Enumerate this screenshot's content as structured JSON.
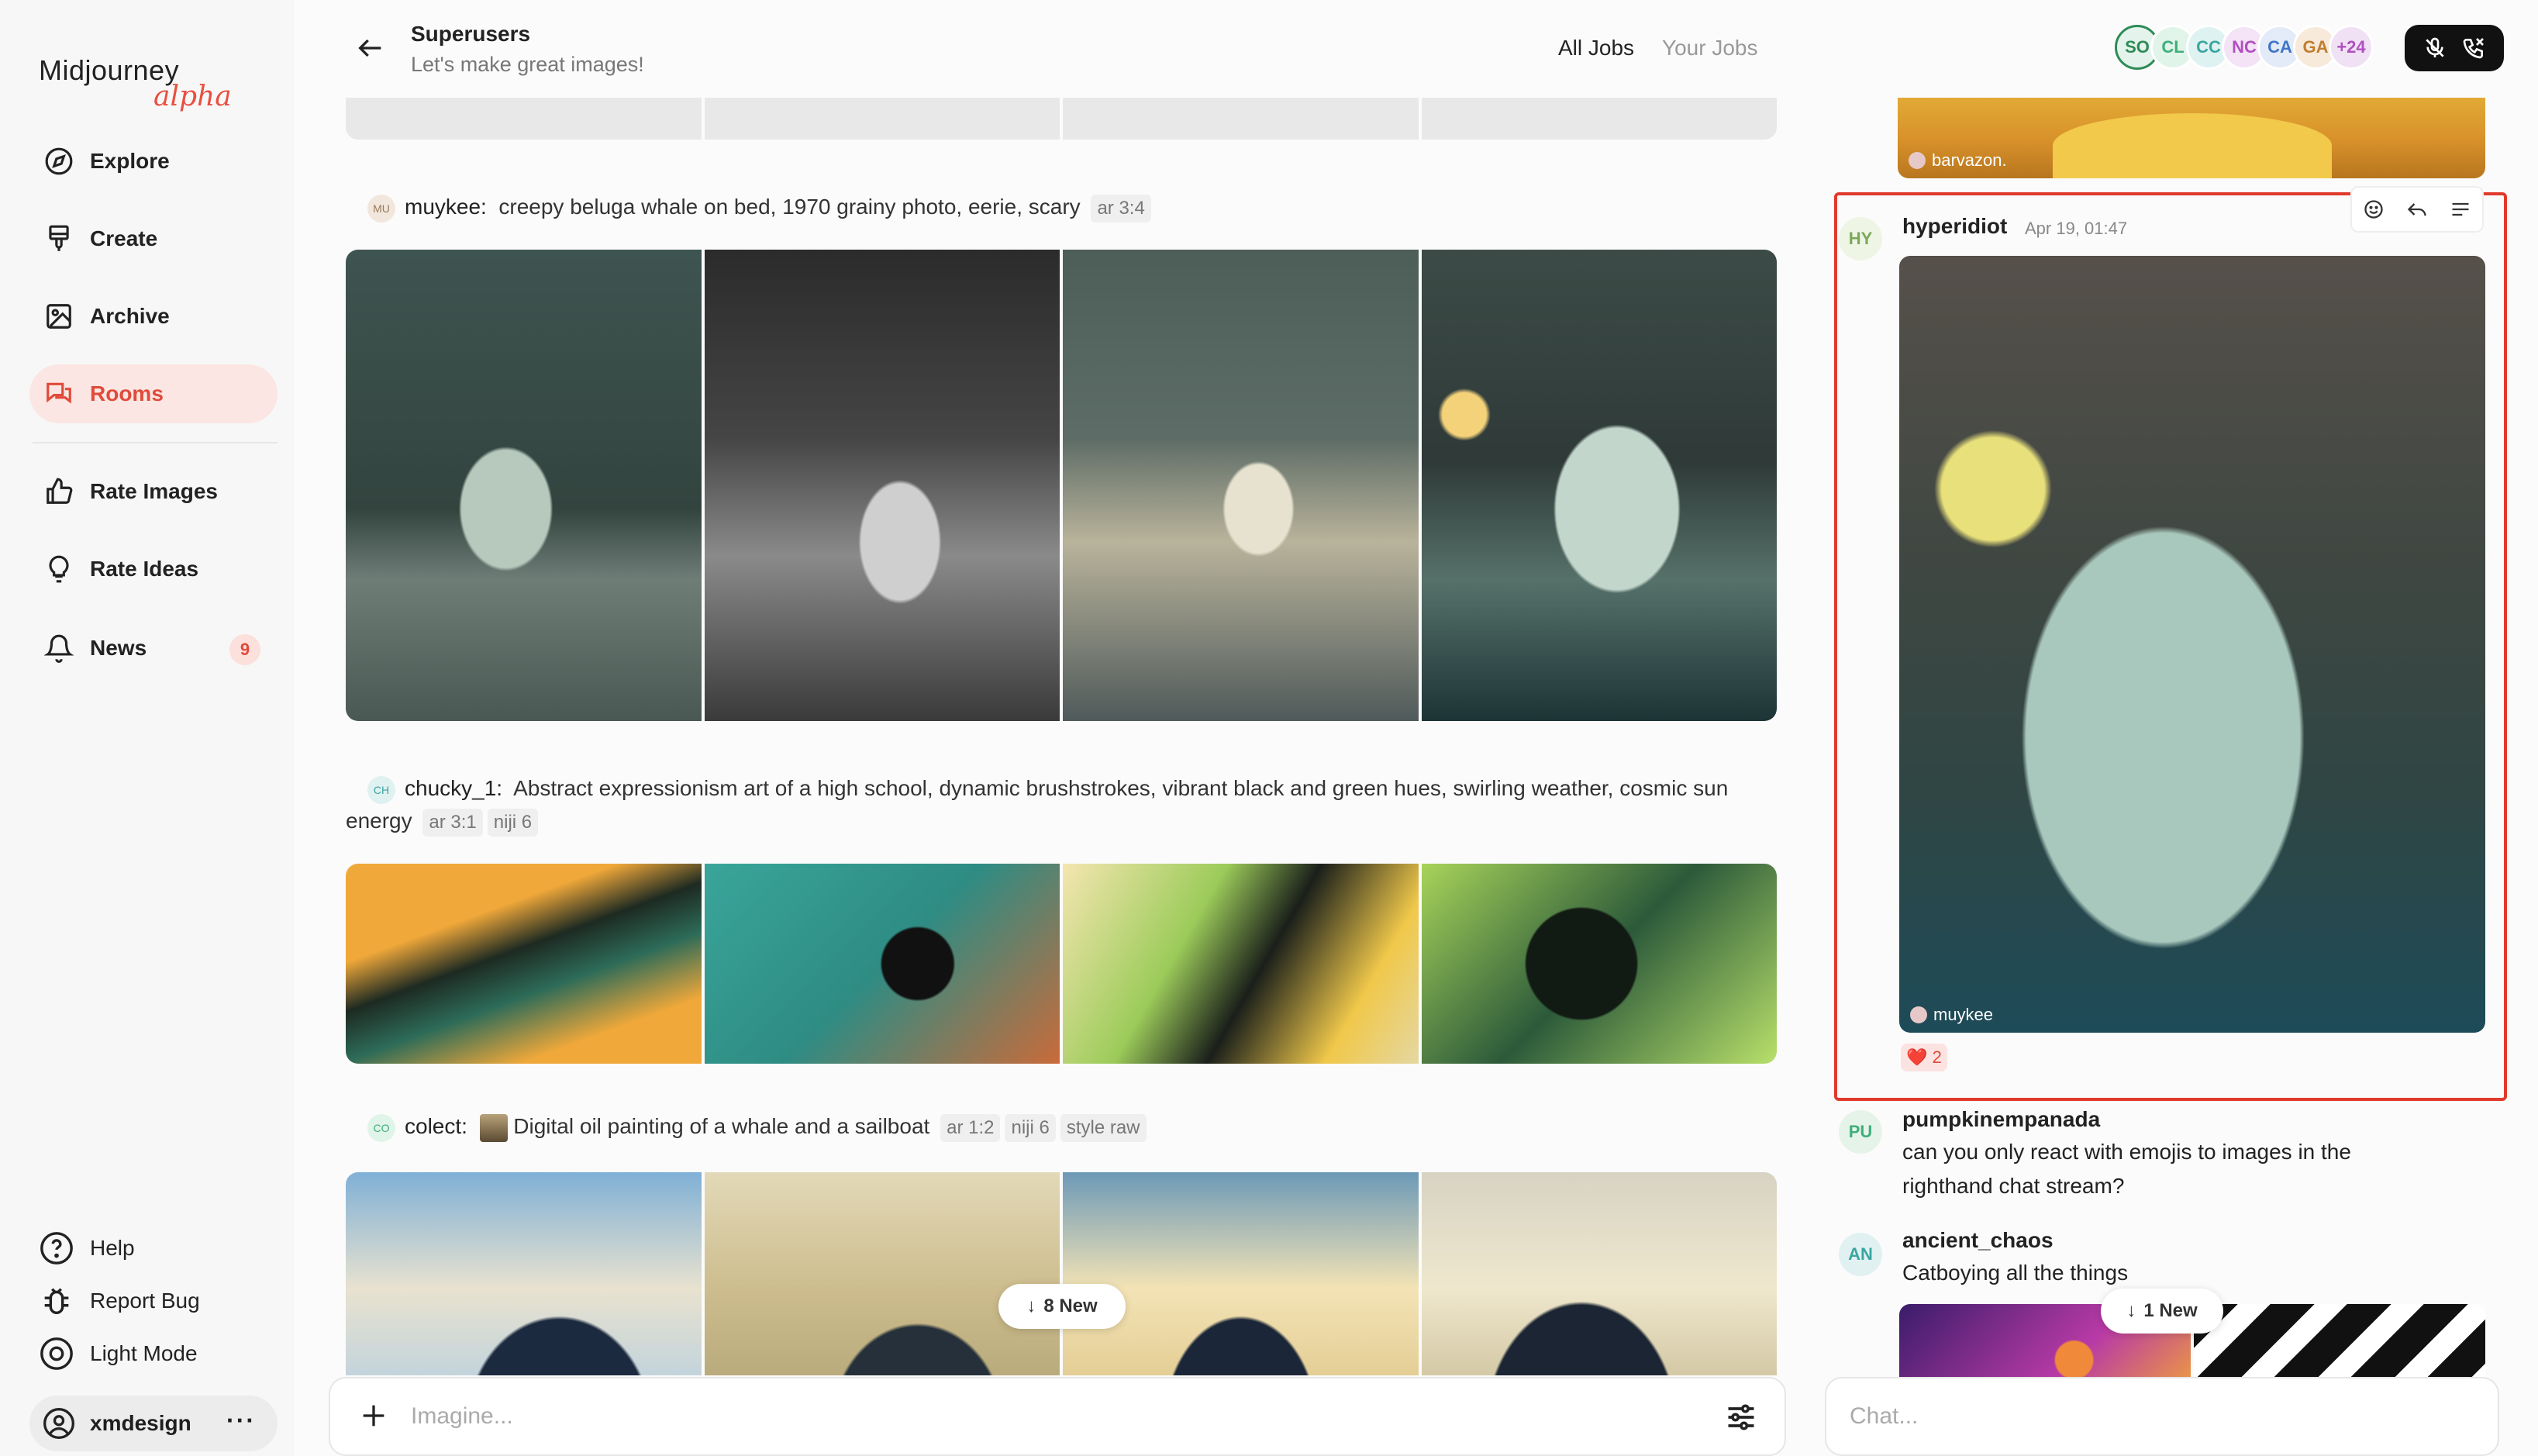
{
  "app": {
    "logo": "Midjourney",
    "logo_sub": "alpha"
  },
  "sidebar": {
    "items": [
      {
        "label": "Explore",
        "icon": "compass-icon"
      },
      {
        "label": "Create",
        "icon": "brush-icon"
      },
      {
        "label": "Archive",
        "icon": "image-icon"
      },
      {
        "label": "Rooms",
        "icon": "chat-bubbles-icon",
        "active": true
      },
      {
        "label": "Rate Images",
        "icon": "thumbs-up-icon"
      },
      {
        "label": "Rate Ideas",
        "icon": "lightbulb-icon"
      },
      {
        "label": "News",
        "icon": "bell-icon",
        "badge": "9"
      }
    ],
    "bottom": [
      {
        "label": "Help",
        "icon": "help-circle-icon"
      },
      {
        "label": "Report Bug",
        "icon": "bug-icon"
      },
      {
        "label": "Light Mode",
        "icon": "sun-icon"
      }
    ],
    "user": "xmdesign",
    "user_more": "···"
  },
  "header": {
    "title": "Superusers",
    "subtitle": "Let's make great images!",
    "tabs": [
      "All Jobs",
      "Your Jobs"
    ],
    "avatars": [
      {
        "initials": "SO",
        "color": "#2e8b57",
        "bg": "#e4f3ec"
      },
      {
        "initials": "CL",
        "color": "#3fae7a",
        "bg": "#e1f4ea"
      },
      {
        "initials": "CC",
        "color": "#3aa6a0",
        "bg": "#def3f1"
      },
      {
        "initials": "NC",
        "color": "#b04fc0",
        "bg": "#f4e3f6"
      },
      {
        "initials": "CA",
        "color": "#3f74c9",
        "bg": "#e3ebf8"
      },
      {
        "initials": "GA",
        "color": "#c07d2f",
        "bg": "#f7eadb"
      },
      {
        "initials": "+24",
        "color": "#b04fc0",
        "bg": "#f1e1f4"
      }
    ]
  },
  "feed": {
    "prompts": [
      {
        "initials": "MU",
        "author": "muykee:",
        "text": "creepy beluga whale on bed, 1970 grainy photo, eerie, scary",
        "chips": [
          "ar 3:4"
        ]
      },
      {
        "initials": "CH",
        "author": "chucky_1:",
        "text": "Abstract expressionism art of a high school, dynamic brushstrokes, vibrant black and green hues, swirling weather, cosmic sun energy",
        "chips": [
          "ar 3:1",
          "niji 6"
        ]
      },
      {
        "initials": "CO",
        "author": "colect:",
        "text": "Digital oil painting of a whale and a sailboat",
        "chips": [
          "ar 1:2",
          "niji 6",
          "style raw"
        ]
      }
    ],
    "new_pill": "8 New"
  },
  "imagine": {
    "placeholder": "Imagine..."
  },
  "chat": {
    "top_credit": "barvazon.",
    "messages": [
      {
        "initials": "HY",
        "name": "hyperidiot",
        "time": "Apr 19, 01:47",
        "credit": "muykee",
        "reaction": "❤️ 2"
      },
      {
        "initials": "PU",
        "name": "pumpkinempanada",
        "text": "can you only react with emojis to images in the righthand chat stream?"
      },
      {
        "initials": "AN",
        "name": "ancient_chaos",
        "text": "Catboying all the things"
      }
    ],
    "new_pill": "1 New",
    "placeholder": "Chat..."
  }
}
